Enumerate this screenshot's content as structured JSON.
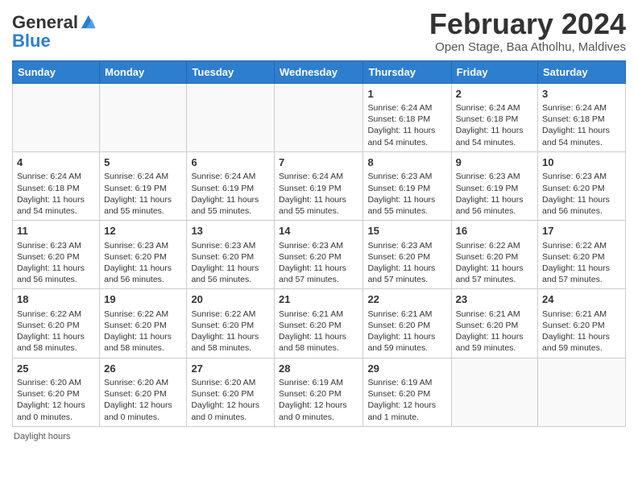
{
  "header": {
    "logo_general": "General",
    "logo_blue": "Blue",
    "title": "February 2024",
    "subtitle": "Open Stage, Baa Atholhu, Maldives"
  },
  "days_of_week": [
    "Sunday",
    "Monday",
    "Tuesday",
    "Wednesday",
    "Thursday",
    "Friday",
    "Saturday"
  ],
  "weeks": [
    [
      {
        "day": "",
        "info": ""
      },
      {
        "day": "",
        "info": ""
      },
      {
        "day": "",
        "info": ""
      },
      {
        "day": "",
        "info": ""
      },
      {
        "day": "1",
        "info": "Sunrise: 6:24 AM\nSunset: 6:18 PM\nDaylight: 11 hours and 54 minutes."
      },
      {
        "day": "2",
        "info": "Sunrise: 6:24 AM\nSunset: 6:18 PM\nDaylight: 11 hours and 54 minutes."
      },
      {
        "day": "3",
        "info": "Sunrise: 6:24 AM\nSunset: 6:18 PM\nDaylight: 11 hours and 54 minutes."
      }
    ],
    [
      {
        "day": "4",
        "info": "Sunrise: 6:24 AM\nSunset: 6:18 PM\nDaylight: 11 hours and 54 minutes."
      },
      {
        "day": "5",
        "info": "Sunrise: 6:24 AM\nSunset: 6:19 PM\nDaylight: 11 hours and 55 minutes."
      },
      {
        "day": "6",
        "info": "Sunrise: 6:24 AM\nSunset: 6:19 PM\nDaylight: 11 hours and 55 minutes."
      },
      {
        "day": "7",
        "info": "Sunrise: 6:24 AM\nSunset: 6:19 PM\nDaylight: 11 hours and 55 minutes."
      },
      {
        "day": "8",
        "info": "Sunrise: 6:23 AM\nSunset: 6:19 PM\nDaylight: 11 hours and 55 minutes."
      },
      {
        "day": "9",
        "info": "Sunrise: 6:23 AM\nSunset: 6:19 PM\nDaylight: 11 hours and 56 minutes."
      },
      {
        "day": "10",
        "info": "Sunrise: 6:23 AM\nSunset: 6:20 PM\nDaylight: 11 hours and 56 minutes."
      }
    ],
    [
      {
        "day": "11",
        "info": "Sunrise: 6:23 AM\nSunset: 6:20 PM\nDaylight: 11 hours and 56 minutes."
      },
      {
        "day": "12",
        "info": "Sunrise: 6:23 AM\nSunset: 6:20 PM\nDaylight: 11 hours and 56 minutes."
      },
      {
        "day": "13",
        "info": "Sunrise: 6:23 AM\nSunset: 6:20 PM\nDaylight: 11 hours and 56 minutes."
      },
      {
        "day": "14",
        "info": "Sunrise: 6:23 AM\nSunset: 6:20 PM\nDaylight: 11 hours and 57 minutes."
      },
      {
        "day": "15",
        "info": "Sunrise: 6:23 AM\nSunset: 6:20 PM\nDaylight: 11 hours and 57 minutes."
      },
      {
        "day": "16",
        "info": "Sunrise: 6:22 AM\nSunset: 6:20 PM\nDaylight: 11 hours and 57 minutes."
      },
      {
        "day": "17",
        "info": "Sunrise: 6:22 AM\nSunset: 6:20 PM\nDaylight: 11 hours and 57 minutes."
      }
    ],
    [
      {
        "day": "18",
        "info": "Sunrise: 6:22 AM\nSunset: 6:20 PM\nDaylight: 11 hours and 58 minutes."
      },
      {
        "day": "19",
        "info": "Sunrise: 6:22 AM\nSunset: 6:20 PM\nDaylight: 11 hours and 58 minutes."
      },
      {
        "day": "20",
        "info": "Sunrise: 6:22 AM\nSunset: 6:20 PM\nDaylight: 11 hours and 58 minutes."
      },
      {
        "day": "21",
        "info": "Sunrise: 6:21 AM\nSunset: 6:20 PM\nDaylight: 11 hours and 58 minutes."
      },
      {
        "day": "22",
        "info": "Sunrise: 6:21 AM\nSunset: 6:20 PM\nDaylight: 11 hours and 59 minutes."
      },
      {
        "day": "23",
        "info": "Sunrise: 6:21 AM\nSunset: 6:20 PM\nDaylight: 11 hours and 59 minutes."
      },
      {
        "day": "24",
        "info": "Sunrise: 6:21 AM\nSunset: 6:20 PM\nDaylight: 11 hours and 59 minutes."
      }
    ],
    [
      {
        "day": "25",
        "info": "Sunrise: 6:20 AM\nSunset: 6:20 PM\nDaylight: 12 hours and 0 minutes."
      },
      {
        "day": "26",
        "info": "Sunrise: 6:20 AM\nSunset: 6:20 PM\nDaylight: 12 hours and 0 minutes."
      },
      {
        "day": "27",
        "info": "Sunrise: 6:20 AM\nSunset: 6:20 PM\nDaylight: 12 hours and 0 minutes."
      },
      {
        "day": "28",
        "info": "Sunrise: 6:19 AM\nSunset: 6:20 PM\nDaylight: 12 hours and 0 minutes."
      },
      {
        "day": "29",
        "info": "Sunrise: 6:19 AM\nSunset: 6:20 PM\nDaylight: 12 hours and 1 minute."
      },
      {
        "day": "",
        "info": ""
      },
      {
        "day": "",
        "info": ""
      }
    ]
  ],
  "footer": {
    "daylight_label": "Daylight hours"
  }
}
